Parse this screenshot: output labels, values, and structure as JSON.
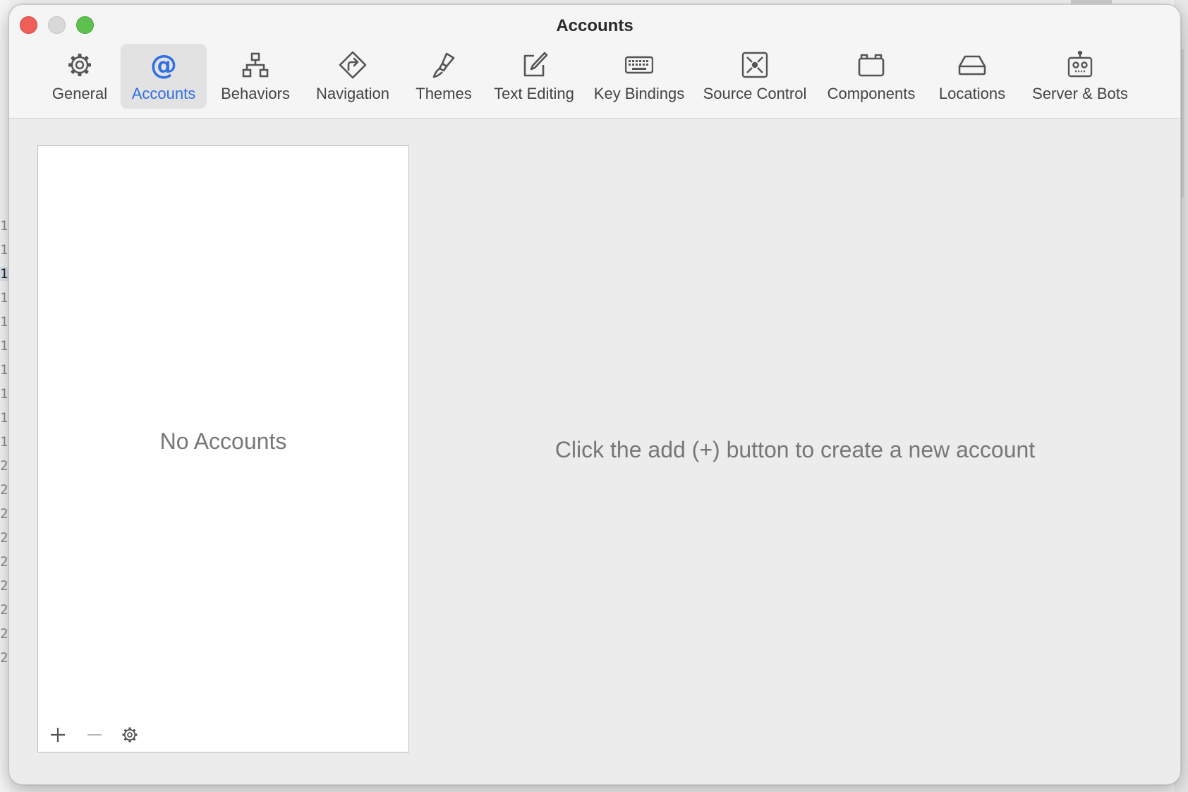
{
  "background": {
    "gutter_lines": [
      "1",
      "1",
      "1",
      "1",
      "1",
      "1",
      "1",
      "1",
      "1",
      "1",
      "2",
      "2",
      "2",
      "2",
      "2",
      "2",
      "2",
      "2",
      "2"
    ]
  },
  "window": {
    "title": "Accounts",
    "traffic_lights": {
      "close": "#ee5f57",
      "minimize": "#d8d8d8",
      "zoom": "#5ec04f"
    }
  },
  "toolbar": {
    "accent": "#2f6fe2",
    "tabs": [
      {
        "label": "General",
        "icon": "gear-icon"
      },
      {
        "label": "Accounts",
        "icon": "at-sign-icon",
        "active": true
      },
      {
        "label": "Behaviors",
        "icon": "hierarchy-icon"
      },
      {
        "label": "Navigation",
        "icon": "turn-right-sign-icon"
      },
      {
        "label": "Themes",
        "icon": "paintbrush-icon"
      },
      {
        "label": "Text Editing",
        "icon": "edit-pencil-icon"
      },
      {
        "label": "Key Bindings",
        "icon": "keyboard-icon"
      },
      {
        "label": "Source Control",
        "icon": "source-control-icon"
      },
      {
        "label": "Components",
        "icon": "folder-box-icon"
      },
      {
        "label": "Locations",
        "icon": "drive-icon"
      },
      {
        "label": "Server & Bots",
        "icon": "robot-icon"
      }
    ]
  },
  "accounts_list": {
    "empty_text": "No Accounts",
    "footer": {
      "add": "+",
      "remove": "—",
      "settings": "gear-icon"
    }
  },
  "detail": {
    "hint": "Click the add (+) button to create a new account"
  }
}
